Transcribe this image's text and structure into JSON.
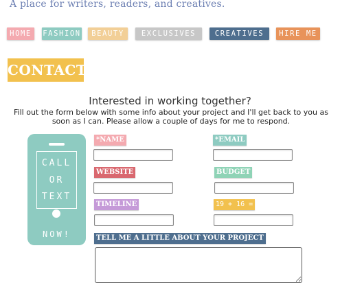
{
  "header": {
    "tagline": "A place for writers, readers, and creatives."
  },
  "nav": {
    "items": [
      {
        "label": "HOME",
        "color": "#f4aab0"
      },
      {
        "label": "FASHION",
        "color": "#8ecbc1"
      },
      {
        "label": "BEAUTY",
        "color": "#f2cf97"
      },
      {
        "label": "EXCLUSIVES",
        "color": "#c7c7c7"
      },
      {
        "label": "CREATIVES",
        "color": "#4e6e8e"
      },
      {
        "label": "HIRE ME",
        "color": "#e8935a"
      }
    ]
  },
  "page": {
    "title": "CONTACT",
    "heading": "Interested in working together?",
    "intro": "Fill out the form below with some info about your project and I'll get back to you as soon as I can. Please allow a couple of days for me to respond."
  },
  "phone": {
    "lines": [
      "CALL",
      "OR",
      "TEXT"
    ],
    "cta": "NOW!"
  },
  "form": {
    "name_label": "*NAME",
    "email_label": "*EMAIL",
    "website_label": "WEBSITE",
    "budget_label": "BUDGET",
    "timeline_label": "TIMELINE",
    "captcha_label": "19 + 16 =",
    "project_label": "TELL ME A LITTLE ABOUT YOUR PROJECT",
    "name_value": "",
    "email_value": "",
    "website_value": "",
    "budget_value": "",
    "timeline_value": "",
    "captcha_value": "",
    "project_value": ""
  },
  "colors": {
    "name": "#f4aab0",
    "email": "#8ecbc1",
    "website": "#d9686f",
    "budget": "#8fd3b6",
    "timeline": "#c59ad8",
    "captcha": "#f2c14e",
    "project": "#4e6e8e"
  }
}
